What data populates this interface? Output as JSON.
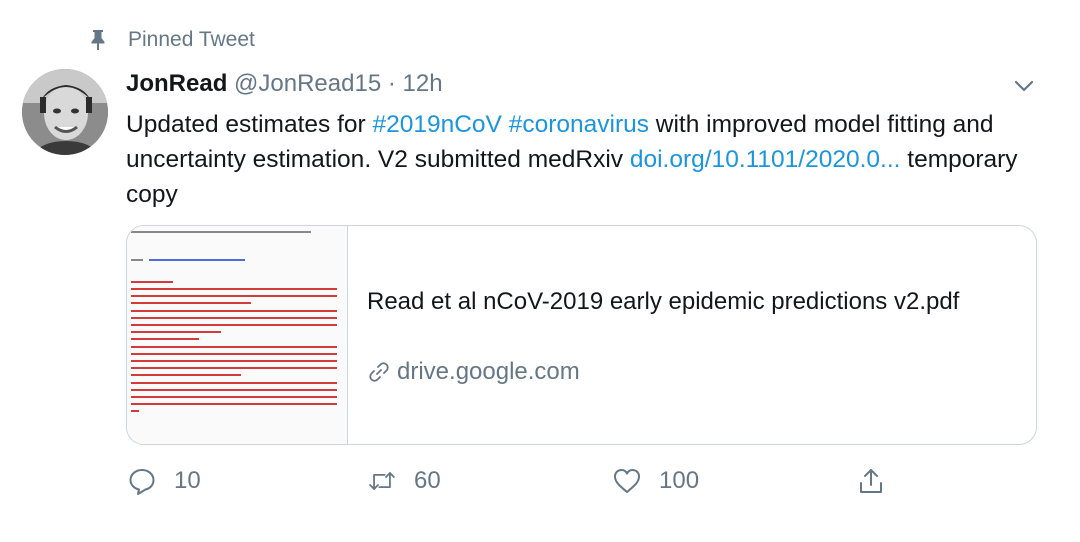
{
  "tweet": {
    "pinned_label": "Pinned Tweet",
    "display_name": "JonRead",
    "handle": "@JonRead15",
    "separator": "·",
    "time": "12h",
    "text_part1": "Updated estimates for ",
    "hashtag1": "#2019nCoV",
    "space": " ",
    "hashtag2": "#coronavirus",
    "text_part2": " with improved model fitting and uncertainty estimation. V2 submitted medRxiv ",
    "link": "doi.org/10.1101/2020.0...",
    "text_part3": " temporary copy"
  },
  "card": {
    "title": "Read et al nCoV-2019 early epidemic predictions v2.pdf",
    "domain": "drive.google.com"
  },
  "actions": {
    "reply_count": "10",
    "retweet_count": "60",
    "like_count": "100"
  },
  "colors": {
    "link": "#1b95e0",
    "muted": "#657786",
    "border": "#ccd6dd",
    "thumb_text": "#d33a3a"
  },
  "icons": {
    "pinned": "pin-icon",
    "caret": "chevron-down-icon",
    "card_link": "link-icon",
    "reply": "reply-icon",
    "retweet": "retweet-icon",
    "like": "heart-icon",
    "share": "share-icon"
  }
}
